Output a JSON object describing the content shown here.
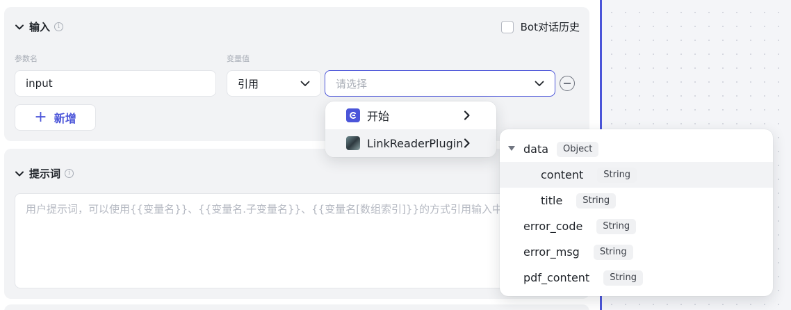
{
  "input_section": {
    "title": "输入",
    "bot_history_label": "Bot对话历史",
    "param_name_label": "参数名",
    "var_value_label": "变量值",
    "param_name_value": "input",
    "ref_type_value": "引用",
    "select_placeholder": "请选择",
    "add_label": "新增"
  },
  "prompt_section": {
    "title": "提示词",
    "placeholder": "用户提示词，可以使用{{变量名}}、{{变量名.子变量名}}、{{变量名[数组索引]}}的方式引用输入中的变量"
  },
  "node_menu": {
    "items": [
      {
        "label": "开始",
        "icon": "start-node-icon"
      },
      {
        "label": "LinkReaderPlugin",
        "icon": "plugin-thumbnail-icon"
      }
    ]
  },
  "output_tree": {
    "items": [
      {
        "name": "data",
        "type": "Object"
      },
      {
        "name": "content",
        "type": "String"
      },
      {
        "name": "title",
        "type": "String"
      },
      {
        "name": "error_code",
        "type": "String"
      },
      {
        "name": "error_msg",
        "type": "String"
      },
      {
        "name": "pdf_content",
        "type": "String"
      }
    ]
  },
  "colors": {
    "accent": "#4b55d9",
    "panel_bg": "#f2f3f5",
    "placeholder": "#a8adb6"
  }
}
